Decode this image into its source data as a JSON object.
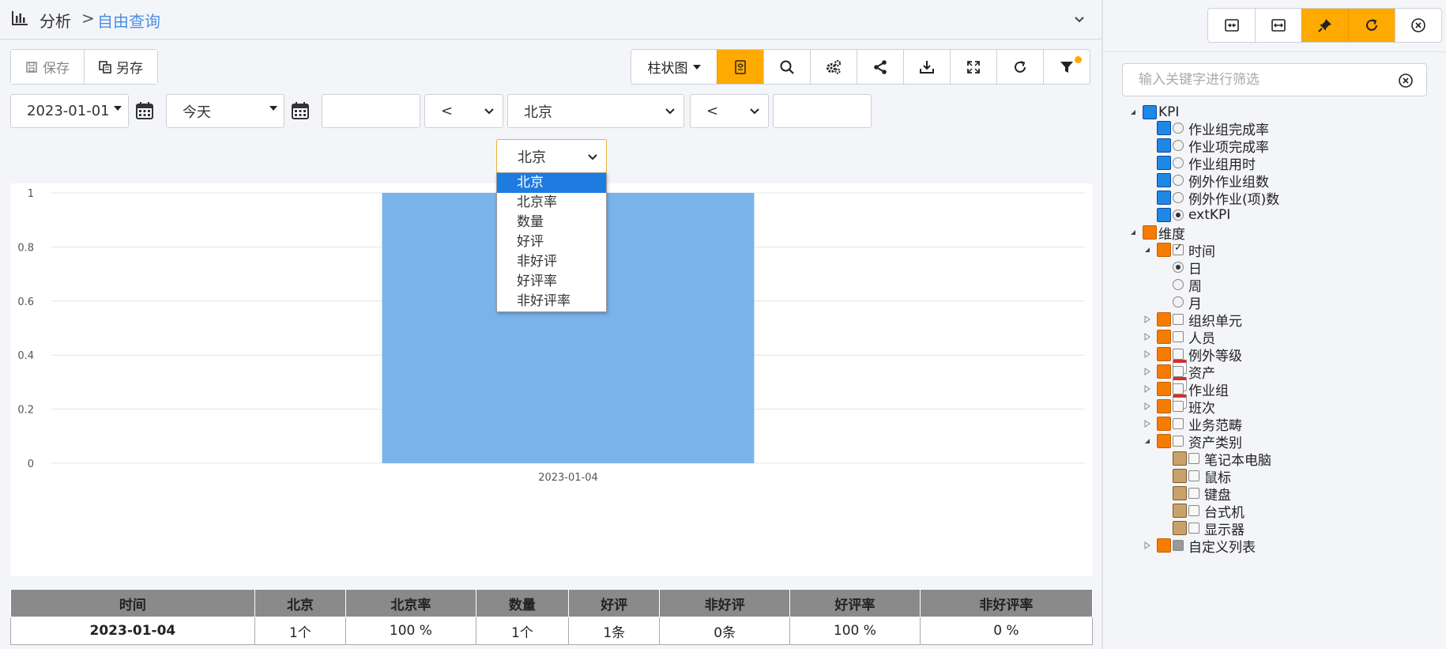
{
  "header": {
    "breadcrumb_parent": "分析",
    "breadcrumb_sep": ">",
    "breadcrumb_current": "自由查询"
  },
  "actions": {
    "save": "保存",
    "save_as": "另存"
  },
  "toolbar": {
    "chart_type": "柱状图"
  },
  "filters": {
    "start_date": "2023-01-01",
    "end_date": "今天",
    "value1": "",
    "op1": "<",
    "field": "北京",
    "op2": "<",
    "value2": ""
  },
  "measure_select": {
    "selected": "北京",
    "options": [
      "北京",
      "北京率",
      "数量",
      "好评",
      "非好评",
      "好评率",
      "非好评率"
    ]
  },
  "chart_data": {
    "type": "bar",
    "categories": [
      "2023-01-04"
    ],
    "values": [
      1
    ],
    "ylim": [
      0,
      1
    ],
    "yticks": [
      0,
      0.2,
      0.4,
      0.6,
      0.8,
      1
    ],
    "ytick_labels": [
      "0",
      "0.2",
      "0.4",
      "0.6",
      "0.8",
      "1"
    ],
    "color": "#7ab3ea",
    "grid": true
  },
  "table": {
    "headers": [
      "时间",
      "北京",
      "北京率",
      "数量",
      "好评",
      "非好评",
      "好评率",
      "非好评率"
    ],
    "rows": [
      [
        "2023-01-04",
        "1个",
        "100 %",
        "1个",
        "1条",
        "0条",
        "100 %",
        "0 %"
      ]
    ]
  },
  "right_panel": {
    "search_placeholder": "输入关键字进行筛选",
    "tree": {
      "kpi_root": "KPI",
      "kpis": [
        "作业组完成率",
        "作业项完成率",
        "作业组用时",
        "例外作业组数",
        "例外作业(项)数",
        "extKPI"
      ],
      "dim_root": "维度",
      "time": "时间",
      "time_children": [
        "日",
        "周",
        "月"
      ],
      "dims": [
        "组织单元",
        "人员",
        "例外等级",
        "资产",
        "作业组",
        "班次",
        "业务范畴"
      ],
      "asset_type": "资产类别",
      "asset_children": [
        "笔记本电脑",
        "鼠标",
        "键盘",
        "台式机",
        "显示器"
      ],
      "custom_list": "自定义列表"
    }
  },
  "colors": {
    "accent": "#ffaa00",
    "link": "#4a8fe7",
    "bar": "#7ab3ea",
    "selected_option": "#1e7be0"
  }
}
